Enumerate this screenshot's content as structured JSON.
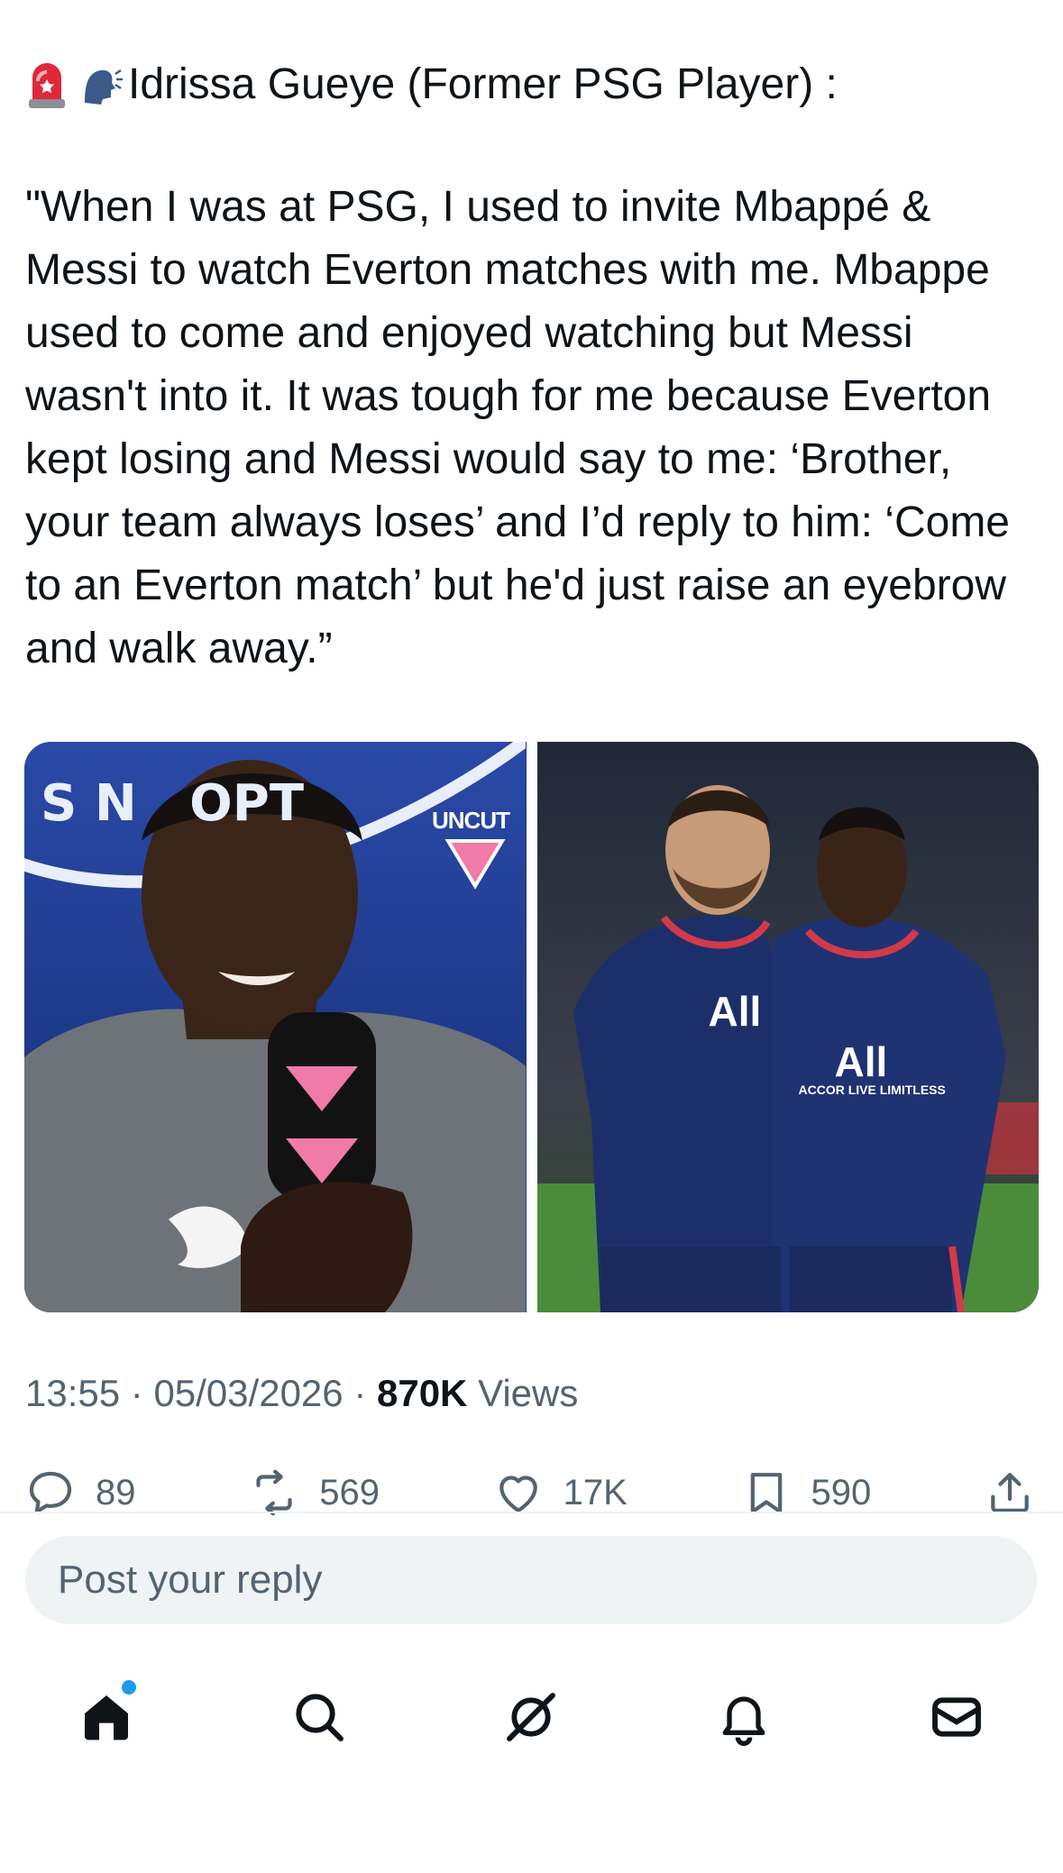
{
  "post": {
    "header": "Idrissa Gueye (Former PSG Player) :",
    "body": "\"When I was at PSG, I used to invite Mbappé & Messi to watch Everton matches with me. Mbappe used to come and enjoyed watching but Messi wasn't into it. It was tough for me because Everton kept losing and Messi would say to me: ‘Brother, your team always loses’ and I’d reply to him: ‘Come to an Everton match’ but he'd just raise an eyebrow and walk away.”",
    "media": {
      "left_overlay": "UNCUT",
      "left_backdrop_text": "S N   OPT",
      "right_shirt_text": "All",
      "right_sponsor_text": "ACCOR LIVE LIMITLESS"
    },
    "time": "13:55",
    "date": "05/03/2026",
    "views_count": "870K",
    "views_label": "Views"
  },
  "actions": {
    "replies": "89",
    "reposts": "569",
    "likes": "17K",
    "bookmarks": "590"
  },
  "reply_box": {
    "placeholder": "Post your reply"
  },
  "colors": {
    "accent": "#1d9bf0",
    "text": "#0f1419",
    "muted": "#536471"
  },
  "nav": {
    "icons": [
      "home-icon",
      "search-icon",
      "grok-icon",
      "notifications-icon",
      "messages-icon"
    ],
    "home_has_badge": true
  }
}
